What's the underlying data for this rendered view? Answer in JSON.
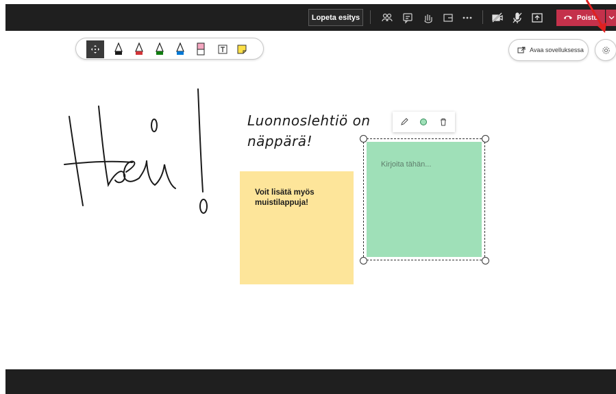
{
  "topbar": {
    "present_label": "Lopeta esitys",
    "hangup_label": "Poistu",
    "icons": [
      "people-icon",
      "chat-icon",
      "reactions-icon",
      "rooms-icon",
      "more-icon",
      "camera-off-icon",
      "mic-off-icon",
      "share-icon",
      "phone-icon",
      "chevron-down-icon"
    ],
    "hangup_color": "#c4314b"
  },
  "ink_toolbar": {
    "tools": [
      "move-tool",
      "black-pen",
      "red-pen",
      "green-pen",
      "blue-pen",
      "highlighter",
      "text-tool",
      "sticky-note-tool"
    ],
    "pen_colors": [
      "#1a1a1a",
      "#d13438",
      "#107c10",
      "#0078d4"
    ],
    "highlighter_color": "#f4a7c0"
  },
  "open_app": {
    "label": "Avaa sovelluksessa"
  },
  "canvas": {
    "handwriting_text_line1": "Luonnoslehtiö on",
    "handwriting_text_line2": "näppärä!",
    "yellow_note": {
      "text": "Voit lisätä myös muistilappuja!",
      "color": "#fde59a"
    },
    "green_note": {
      "placeholder": "Kirjoita tähän...",
      "color": "#9fe0b8"
    }
  }
}
